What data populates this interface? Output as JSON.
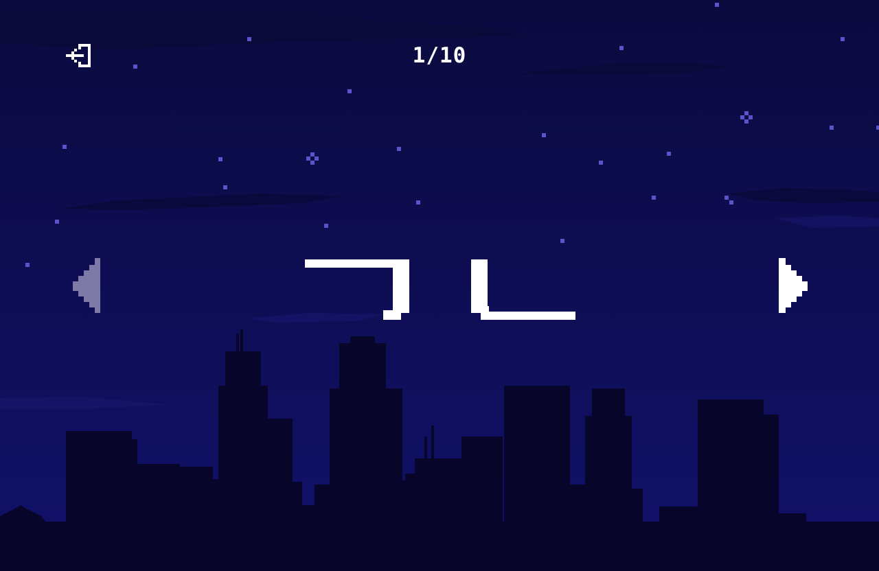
{
  "hud": {
    "counter": "1/10",
    "exit_icon": "exit-door-icon"
  },
  "navigation": {
    "prev_icon": "triangle-left-icon",
    "prev_state": "disabled",
    "next_icon": "triangle-right-icon",
    "next_state": "enabled"
  },
  "card": {
    "glyph_icon": "hangul-glyph-icon"
  },
  "colors": {
    "sky_top": "#0b0a3e",
    "sky_bottom": "#12106a",
    "star": "#5b53c9",
    "skyline": "#07062a",
    "text": "#ffffff",
    "disabled_arrow": "#7d7aa8"
  }
}
